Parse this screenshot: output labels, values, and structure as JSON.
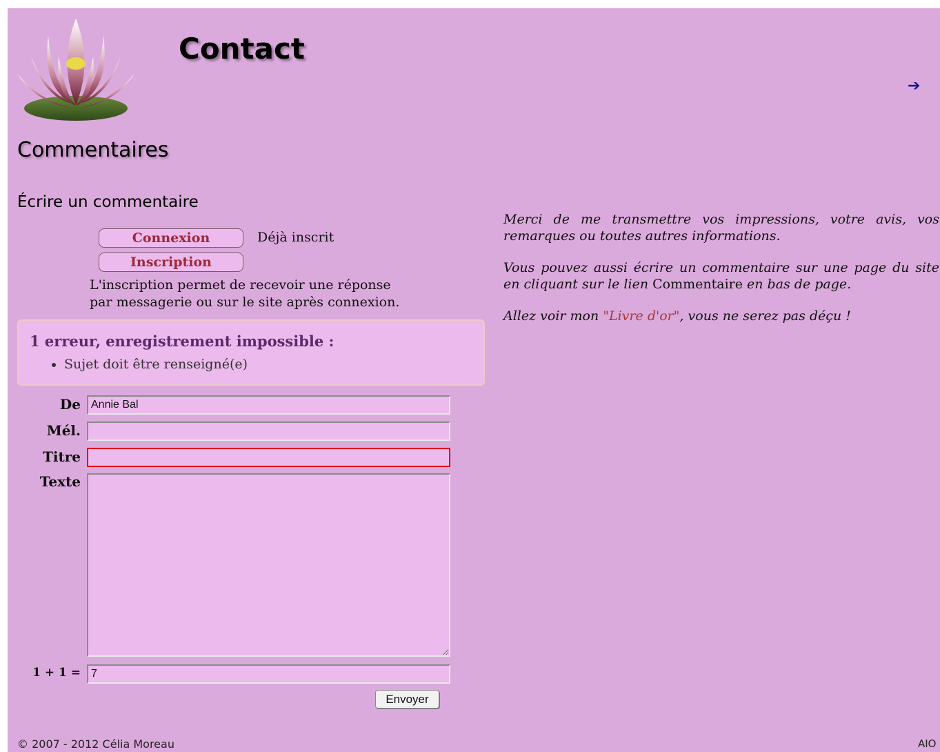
{
  "header": {
    "title": "Contact",
    "nav_arrow": "➔"
  },
  "comments": {
    "heading": "Commentaires",
    "subheading": "Écrire un commentaire",
    "login_button": "Connexion",
    "already_registered": "Déjà inscrit",
    "signup_button": "Inscription",
    "signup_info": "L'inscription permet de recevoir une réponse par messagerie ou sur le site après connexion."
  },
  "error": {
    "title": "1 erreur, enregistrement impossible :",
    "items": [
      "Sujet doit être renseigné(e)"
    ]
  },
  "form": {
    "from_label": "De",
    "from_value": "Annie Bal",
    "email_label": "Mél.",
    "email_value": "",
    "subject_label": "Titre",
    "subject_value": "",
    "text_label": "Texte",
    "text_value": "",
    "captcha_label": "1 + 1 =",
    "captcha_value": "7",
    "submit_label": "Envoyer"
  },
  "side": {
    "p1": "Merci de me transmettre vos impressions, votre avis, vos remarques ou toutes autres informations.",
    "p2_a": "Vous pouvez aussi écrire un commentaire sur une page du site en cliquant sur le lien ",
    "p2_link": "Commentaire",
    "p2_b": " en bas de page.",
    "p3_a": "Allez voir mon ",
    "p3_link": "\"Livre d'or\"",
    "p3_b": ", vous ne serez pas déçu !"
  },
  "footer": {
    "copyright": "© 2007 - 2012 Célia Moreau",
    "right": "AIO"
  },
  "colors": {
    "page_background": "#dbaadc",
    "field_background": "#ecbaec",
    "button_text": "#9b2a3a",
    "error_border": "#e0001a",
    "link": "#a83838"
  },
  "icons": {
    "logo": "lotus-flower-logo",
    "nav": "right-arrow-icon"
  }
}
